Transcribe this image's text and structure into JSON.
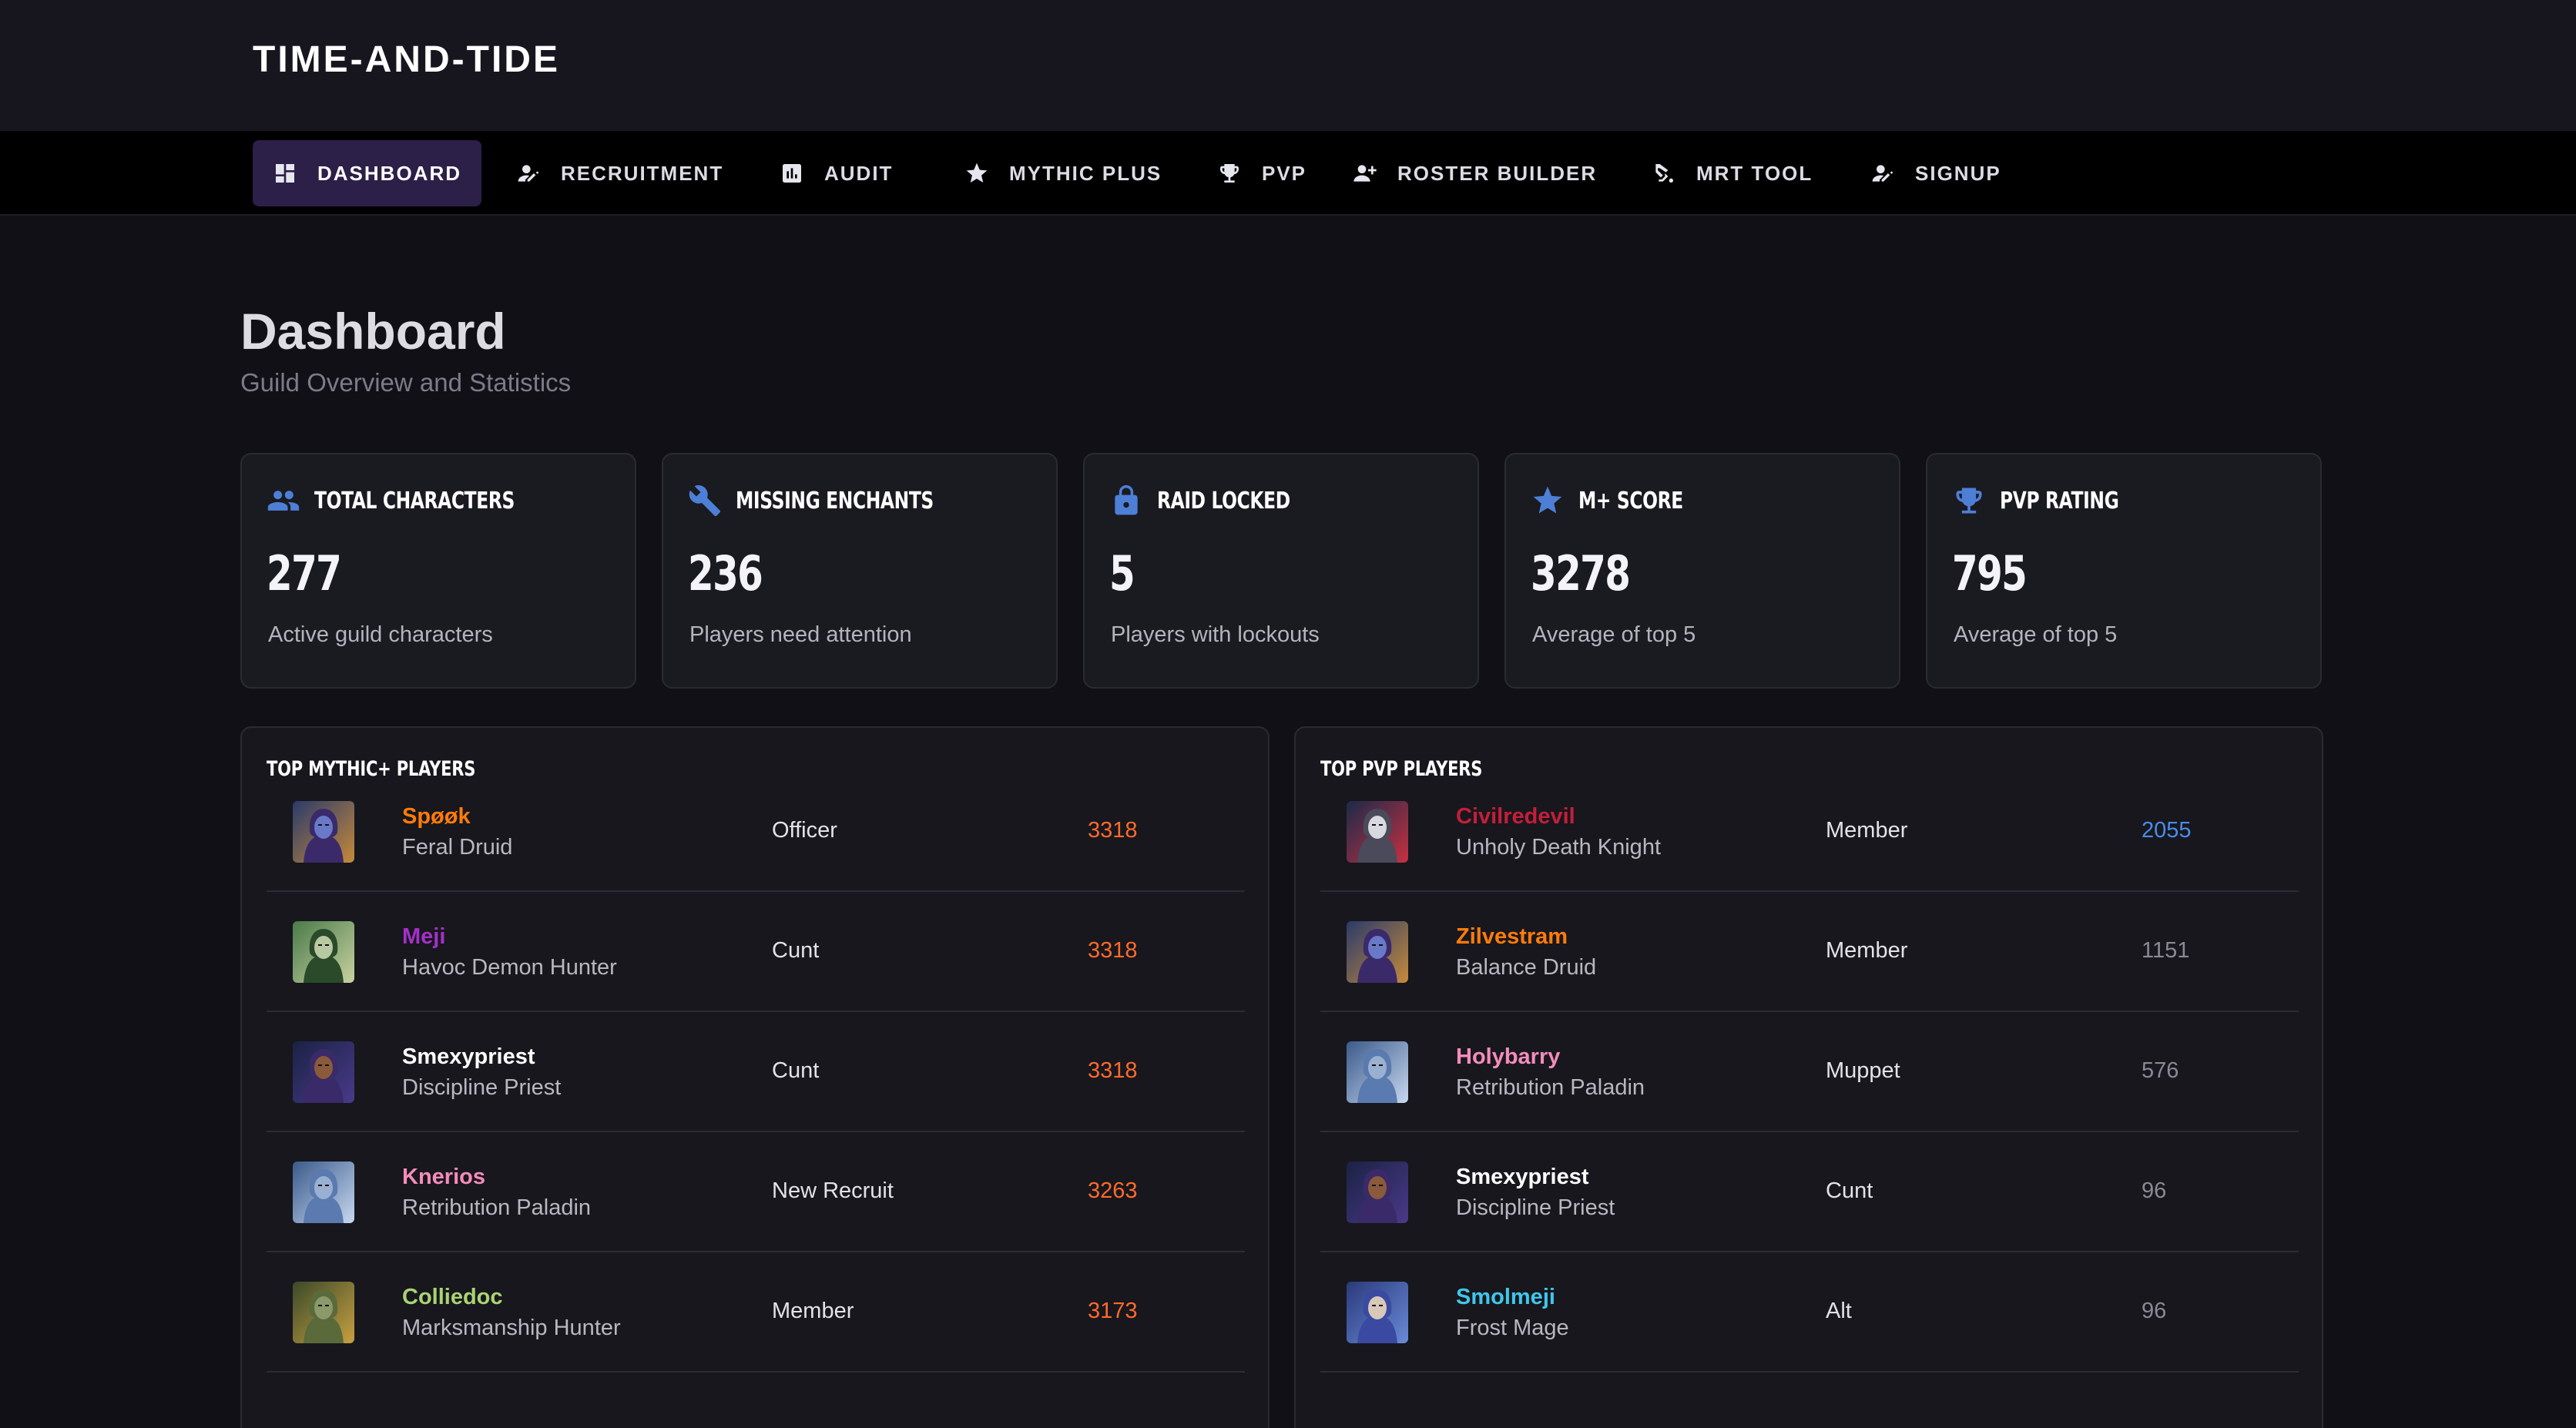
{
  "app": {
    "title": "TIME-AND-TIDE"
  },
  "nav": [
    {
      "label": "DASHBOARD",
      "icon": "dashboard-icon",
      "active": true
    },
    {
      "label": "RECRUITMENT",
      "icon": "person-edit-icon"
    },
    {
      "label": "AUDIT",
      "icon": "bar-chart-icon"
    },
    {
      "label": "MYTHIC PLUS",
      "icon": "star-icon"
    },
    {
      "label": "PVP",
      "icon": "trophy-icon"
    },
    {
      "label": "ROSTER BUILDER",
      "icon": "person-add-icon"
    },
    {
      "label": "MRT TOOL",
      "icon": "precision-tool-icon"
    },
    {
      "label": "SIGNUP",
      "icon": "person-edit-icon"
    }
  ],
  "page": {
    "title": "Dashboard",
    "subtitle": "Guild Overview and Statistics"
  },
  "stats": [
    {
      "title": "TOTAL CHARACTERS",
      "value": "277",
      "desc": "Active guild characters",
      "icon": "group-icon"
    },
    {
      "title": "MISSING ENCHANTS",
      "value": "236",
      "desc": "Players need attention",
      "icon": "wrench-icon"
    },
    {
      "title": "RAID LOCKED",
      "value": "5",
      "desc": "Players with lockouts",
      "icon": "lock-icon"
    },
    {
      "title": "M+ SCORE",
      "value": "3278",
      "desc": "Average of top 5",
      "icon": "star-icon"
    },
    {
      "title": "PVP RATING",
      "value": "795",
      "desc": "Average of top 5",
      "icon": "trophy-icon"
    }
  ],
  "mythic_panel": {
    "title": "TOP MYTHIC+ PLAYERS",
    "players": [
      {
        "name": "Spøøk",
        "spec": "Feral Druid",
        "rank": "Officer",
        "score": "3318",
        "name_color": "#ff7c0a",
        "score_color": "#ff6a2a",
        "avatar": "druid-portrait"
      },
      {
        "name": "Meji",
        "spec": "Havoc Demon Hunter",
        "rank": "Cunt",
        "score": "3318",
        "name_color": "#a330c9",
        "score_color": "#ff6a2a",
        "avatar": "demon-hunter-portrait"
      },
      {
        "name": "Smexypriest",
        "spec": "Discipline Priest",
        "rank": "Cunt",
        "score": "3318",
        "name_color": "#ffffff",
        "score_color": "#ff6a2a",
        "avatar": "priest-portrait"
      },
      {
        "name": "Knerios",
        "spec": "Retribution Paladin",
        "rank": "New Recruit",
        "score": "3263",
        "name_color": "#f48cba",
        "score_color": "#ff6a2a",
        "avatar": "paladin-portrait"
      },
      {
        "name": "Colliedoc",
        "spec": "Marksmanship Hunter",
        "rank": "Member",
        "score": "3173",
        "name_color": "#aad372",
        "score_color": "#ff6a2a",
        "avatar": "hunter-portrait"
      }
    ]
  },
  "pvp_panel": {
    "title": "TOP PVP PLAYERS",
    "players": [
      {
        "name": "Civilredevil",
        "spec": "Unholy Death Knight",
        "rank": "Member",
        "score": "2055",
        "name_color": "#c41e3a",
        "score_color": "#4a8ce8",
        "avatar": "death-knight-portrait"
      },
      {
        "name": "Zilvestram",
        "spec": "Balance Druid",
        "rank": "Member",
        "score": "1151",
        "name_color": "#ff7c0a",
        "score_color": "#8a8a94",
        "avatar": "druid-portrait"
      },
      {
        "name": "Holybarry",
        "spec": "Retribution Paladin",
        "rank": "Muppet",
        "score": "576",
        "name_color": "#f48cba",
        "score_color": "#8a8a94",
        "avatar": "paladin-portrait"
      },
      {
        "name": "Smexypriest",
        "spec": "Discipline Priest",
        "rank": "Cunt",
        "score": "96",
        "name_color": "#ffffff",
        "score_color": "#8a8a94",
        "avatar": "priest-portrait"
      },
      {
        "name": "Smolmeji",
        "spec": "Frost Mage",
        "rank": "Alt",
        "score": "96",
        "name_color": "#3fc7eb",
        "score_color": "#8a8a94",
        "avatar": "mage-portrait"
      }
    ]
  }
}
